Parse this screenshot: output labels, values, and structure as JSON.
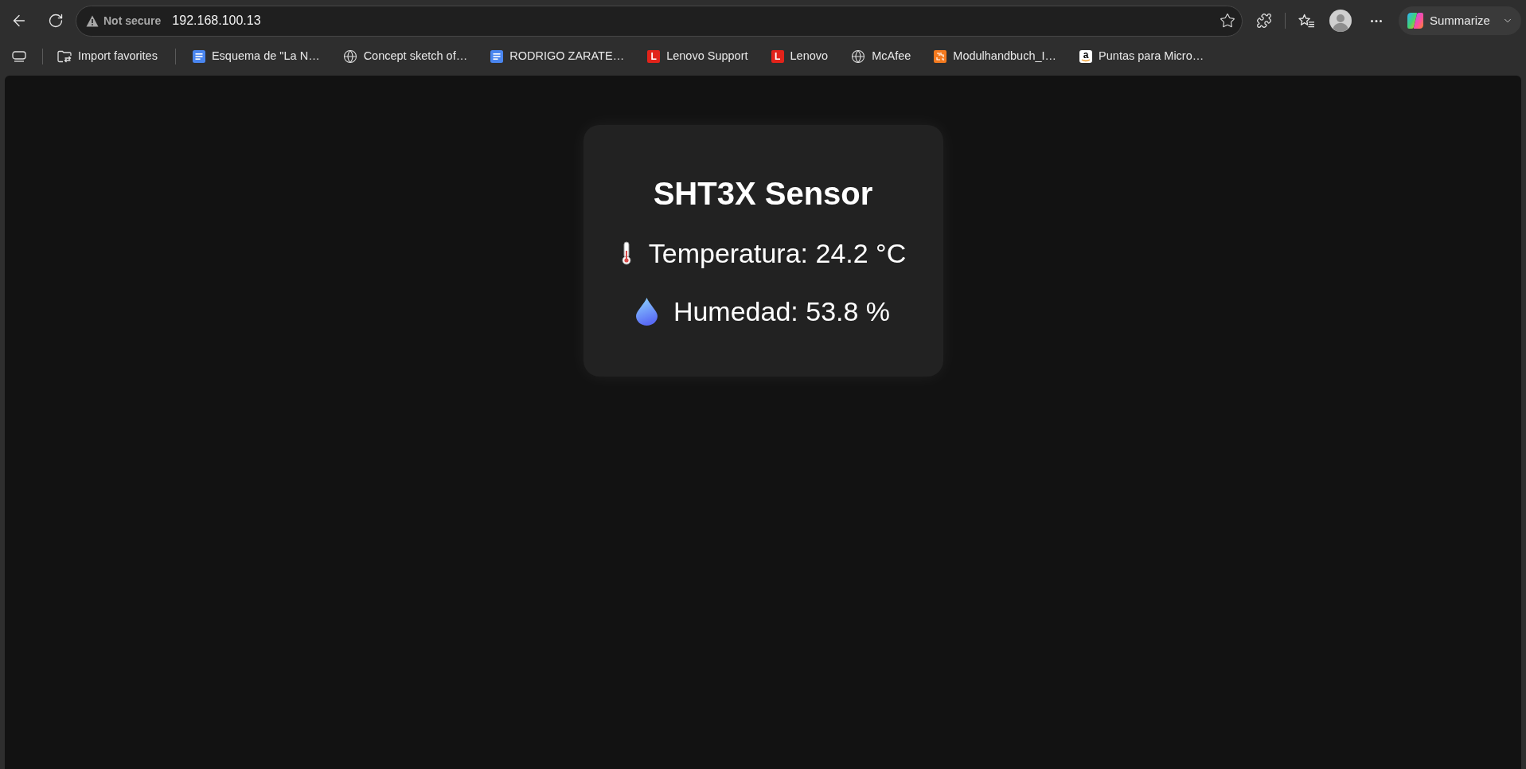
{
  "toolbar": {
    "security_label": "Not secure",
    "url": "192.168.100.13",
    "summarize_label": "Summarize"
  },
  "bookmarks_bar": {
    "items": [
      {
        "label": "Import favorites",
        "kind": "import"
      },
      {
        "label": "Esquema de \"La N…",
        "kind": "doc"
      },
      {
        "label": "Concept sketch of…",
        "kind": "globe"
      },
      {
        "label": "RODRIGO ZARATE…",
        "kind": "doc"
      },
      {
        "label": "Lenovo Support",
        "kind": "letter",
        "icon_text": "L"
      },
      {
        "label": "Lenovo",
        "kind": "letter",
        "icon_text": "L"
      },
      {
        "label": "McAfee",
        "kind": "globe"
      },
      {
        "label": "Modulhandbuch_I…",
        "kind": "pattern"
      },
      {
        "label": "Puntas para Micro…",
        "kind": "letter-smile",
        "icon_text": "a"
      }
    ]
  },
  "page": {
    "card": {
      "title": "SHT3X Sensor",
      "readings": [
        {
          "kind": "temperature",
          "text": "Temperatura: 24.2 °C"
        },
        {
          "kind": "humidity",
          "text": "Humedad: 53.8 %"
        }
      ]
    }
  }
}
